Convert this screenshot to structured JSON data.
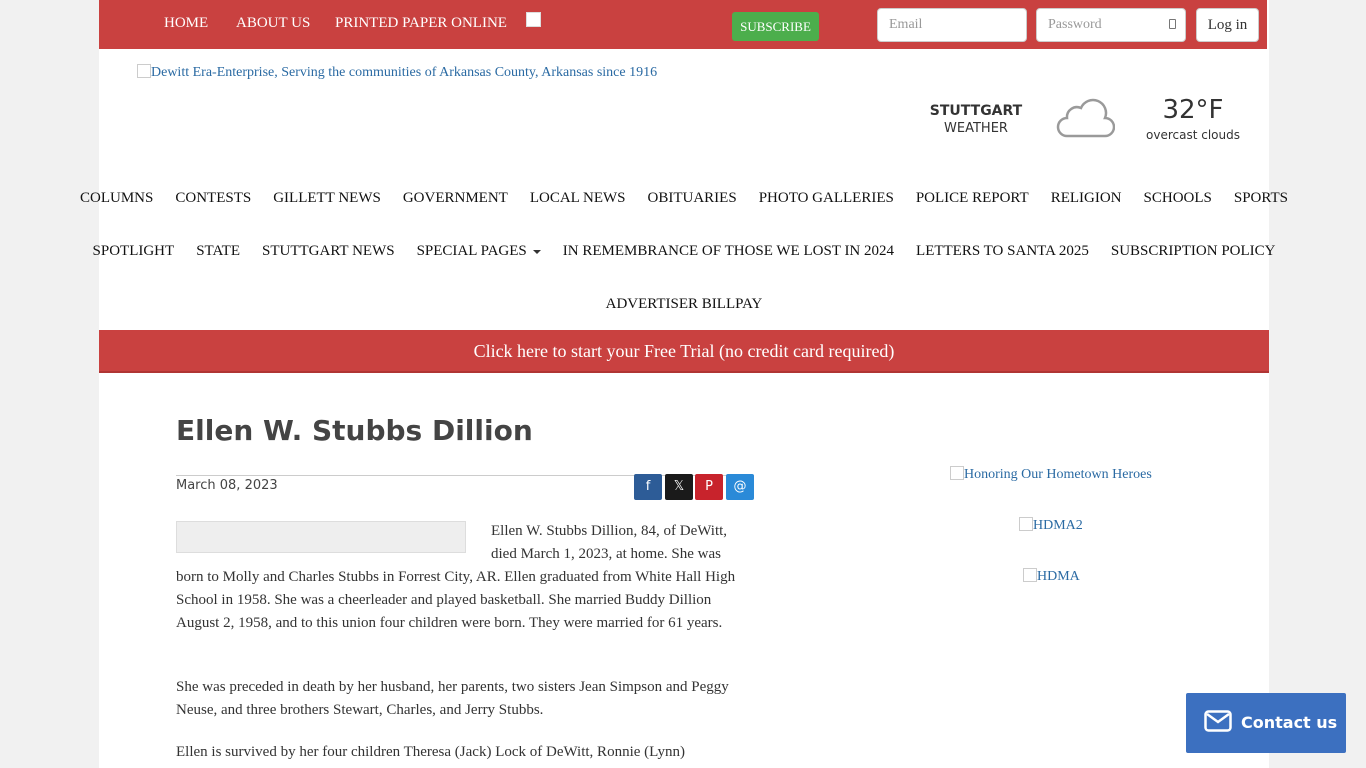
{
  "topnav": {
    "items": [
      "HOME",
      "ABOUT US",
      "PRINTED PAPER ONLINE"
    ],
    "subscribe_label": "SUBSCRIBE",
    "email_placeholder": "Email",
    "password_placeholder": "Password",
    "login_label": "Log in"
  },
  "masthead": {
    "logo_alt": "Dewitt Era-Enterprise, Serving the communities of Arkansas County, Arkansas since 1916"
  },
  "weather": {
    "city": "STUTTGART",
    "label": "WEATHER",
    "temperature": "32°F",
    "condition": "overcast clouds",
    "icon": "cloud-icon"
  },
  "nav": {
    "row1": [
      "COLUMNS",
      "CONTESTS",
      "GILLETT NEWS",
      "GOVERNMENT",
      "LOCAL NEWS",
      "OBITUARIES",
      "PHOTO GALLERIES",
      "POLICE REPORT",
      "RELIGION",
      "SCHOOLS",
      "SPORTS"
    ],
    "row2": [
      "SPOTLIGHT",
      "STATE",
      "STUTTGART NEWS",
      "SPECIAL PAGES",
      "IN REMEMBRANCE OF THOSE WE LOST IN 2024",
      "LETTERS TO SANTA 2025",
      "SUBSCRIPTION POLICY"
    ],
    "row3": [
      "ADVERTISER BILLPAY"
    ]
  },
  "banner": {
    "trial_text": "Click here to start your Free Trial (no credit card required)"
  },
  "article": {
    "title": "Ellen W. Stubbs Dillion",
    "date": "March 08, 2023",
    "share_icons": [
      "facebook-icon",
      "x-icon",
      "pinterest-icon",
      "email-icon"
    ],
    "share_glyphs": [
      "f",
      "𝕏",
      "P",
      "@"
    ],
    "p1_part1": "Ellen W. Stubbs Dillion, 84, of DeWitt, died March 1, 2023, at home. She was",
    "p1_part2": "born to Molly and Charles Stubbs in Forrest City, AR. Ellen graduated from White Hall High School in 1958. She was a cheerleader and played basketball. She married Buddy Dillion August 2, 1958, and to this union four children were born. They were married for 61 years.",
    "p2": "She was preceded in death by her husband, her parents, two sisters Jean Simpson and Peggy Neuse, and three brothers Stewart, Charles, and Jerry Stubbs.",
    "p3": "Ellen is survived by her four children Theresa (Jack) Lock of DeWitt, Ronnie (Lynn)"
  },
  "sidebar": {
    "ads": [
      "Honoring Our Hometown Heroes",
      "HDMA2",
      "HDMA"
    ]
  },
  "contact": {
    "label": "Contact us"
  },
  "colors": {
    "brand_red": "#c94140",
    "subscribe_green": "#4cae4c",
    "contact_blue": "#3c70c0",
    "share_facebook": "#2d5c97",
    "share_x": "#1a1a1a",
    "share_pinterest": "#c8232c",
    "share_email": "#2a8ad8"
  }
}
